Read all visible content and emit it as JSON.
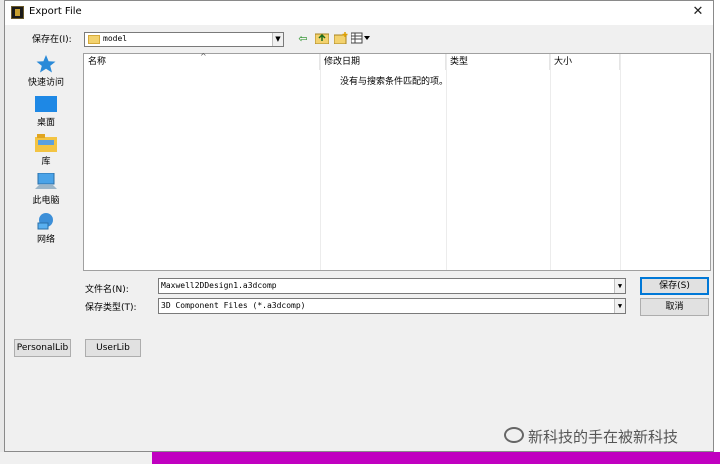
{
  "window": {
    "title": "Export File",
    "close_label": "✕"
  },
  "toolbar": {
    "save_in_label": "保存在(I):",
    "location_value": "model",
    "back_icon": "back-arrow-icon",
    "up_icon": "up-folder-icon",
    "new_folder_icon": "new-folder-icon",
    "view_icon": "view-menu-icon"
  },
  "places": [
    {
      "label": "快速访问",
      "icon": "star-icon"
    },
    {
      "label": "桌面",
      "icon": "desktop-icon"
    },
    {
      "label": "库",
      "icon": "library-icon"
    },
    {
      "label": "此电脑",
      "icon": "computer-icon"
    },
    {
      "label": "网络",
      "icon": "network-icon"
    }
  ],
  "listview": {
    "columns": [
      "名称",
      "修改日期",
      "类型",
      "大小"
    ],
    "empty_message": "没有与搜索条件匹配的项。"
  },
  "form": {
    "filename_label": "文件名(N):",
    "filename_value": "Maxwell2DDesign1.a3dcomp",
    "filetype_label": "保存类型(T):",
    "filetype_value": "3D Component Files (*.a3dcomp)",
    "save_button": "保存(S)",
    "cancel_button": "取消"
  },
  "extra_buttons": {
    "personal_lib": "PersonalLib",
    "user_lib": "UserLib"
  },
  "watermark": {
    "text": "新科技的手在被新科技"
  },
  "colors": {
    "accent": "#0078d7",
    "folder": "#f3d26e",
    "magenta": "#c000c0"
  }
}
